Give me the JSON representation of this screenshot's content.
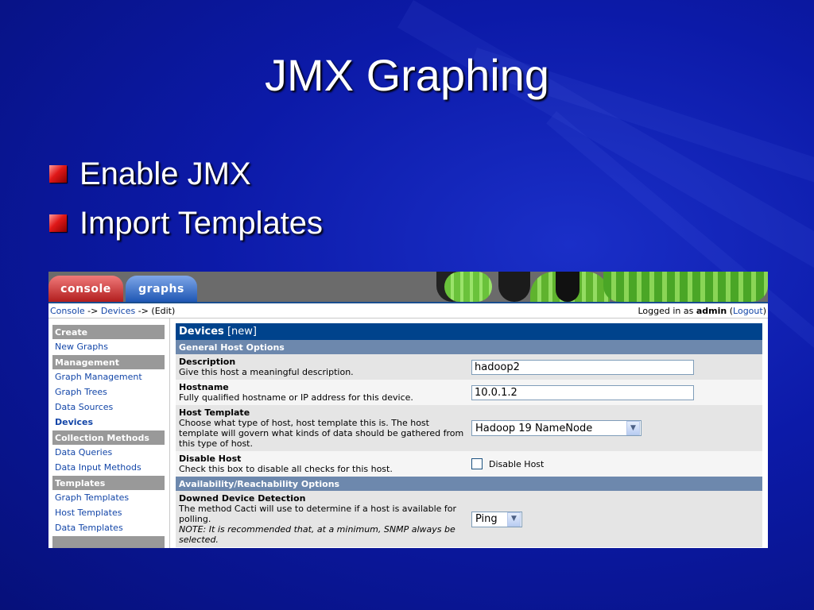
{
  "slide": {
    "title": "JMX Graphing",
    "bullets": [
      "Enable JMX",
      "Import Templates"
    ]
  },
  "app": {
    "tabs": [
      {
        "label": "console"
      },
      {
        "label": "graphs"
      }
    ],
    "breadcrumb": {
      "console": "Console",
      "sep1": " -> ",
      "devices": "Devices",
      "sep2": " -> ",
      "edit": "(Edit)"
    },
    "login": {
      "prefix": "Logged in as ",
      "user": "admin",
      "logout": "Logout"
    },
    "sidebar": [
      {
        "label": "Create",
        "type": "header"
      },
      {
        "label": "New Graphs",
        "type": "link"
      },
      {
        "label": "Management",
        "type": "header"
      },
      {
        "label": "Graph Management",
        "type": "link"
      },
      {
        "label": "Graph Trees",
        "type": "link"
      },
      {
        "label": "Data Sources",
        "type": "link"
      },
      {
        "label": "Devices",
        "type": "current"
      },
      {
        "label": "Collection Methods",
        "type": "header"
      },
      {
        "label": "Data Queries",
        "type": "link"
      },
      {
        "label": "Data Input Methods",
        "type": "link"
      },
      {
        "label": "Templates",
        "type": "header"
      },
      {
        "label": "Graph Templates",
        "type": "link"
      },
      {
        "label": "Host Templates",
        "type": "link"
      },
      {
        "label": "Data Templates",
        "type": "link"
      }
    ],
    "form": {
      "title": "Devices",
      "title_suffix": "[new]",
      "section1": "General Host Options",
      "description": {
        "label": "Description",
        "help": "Give this host a meaningful description.",
        "value": "hadoop2"
      },
      "hostname": {
        "label": "Hostname",
        "help": "Fully qualified hostname or IP address for this device.",
        "value": "10.0.1.2"
      },
      "host_template": {
        "label": "Host Template",
        "help": "Choose what type of host, host template this is. The host template will govern what kinds of data should be gathered from this type of host.",
        "value": "Hadoop 19 NameNode"
      },
      "disable_host": {
        "label": "Disable Host",
        "help": "Check this box to disable all checks for this host.",
        "checkbox_label": "Disable Host"
      },
      "section2": "Availability/Reachability Options",
      "downed": {
        "label": "Downed Device Detection",
        "help": "The method Cacti will use to determine if a host is available for polling.",
        "note": "NOTE: It is recommended that, at a minimum, SNMP always be selected.",
        "value": "Ping"
      }
    }
  },
  "colors": {
    "console_tab": "#c03030",
    "graphs_tab": "#2a62c0",
    "header_blue": "#00438c",
    "section_blue": "#6d88ad"
  }
}
